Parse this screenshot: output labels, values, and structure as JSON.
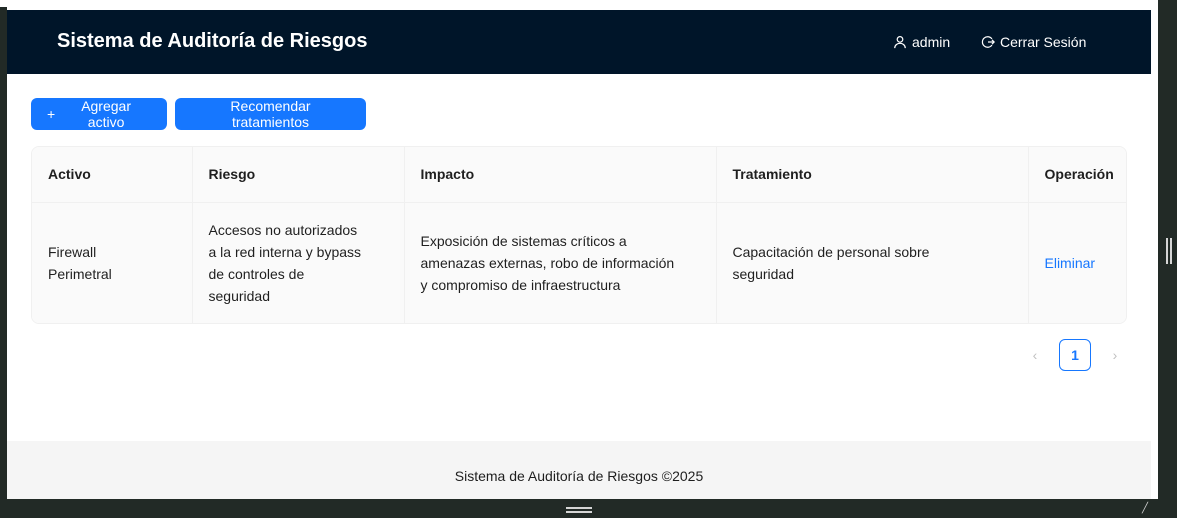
{
  "header": {
    "title": "Sistema de Auditoría de Riesgos",
    "user_label": "admin",
    "logout_label": "Cerrar Sesión"
  },
  "actions": {
    "add_label": "Agregar activo",
    "recommend_label": "Recomendar tratamientos"
  },
  "table": {
    "columns": [
      "Activo",
      "Riesgo",
      "Impacto",
      "Tratamiento",
      "Operación"
    ],
    "rows": [
      {
        "activo": "Firewall Perimetral",
        "riesgo": "Accesos no autorizados a la red interna y bypass de controles de seguridad",
        "impacto": "Exposición de sistemas críticos a amenazas externas, robo de información y compromiso de infraestructura",
        "tratamiento": "Capacitación de personal sobre seguridad",
        "operacion": "Eliminar"
      }
    ]
  },
  "pagination": {
    "current_page": "1"
  },
  "footer": {
    "text": "Sistema de Auditoría de Riesgos ©2025"
  },
  "colors": {
    "header_bg": "#001529",
    "primary": "#1677ff"
  }
}
